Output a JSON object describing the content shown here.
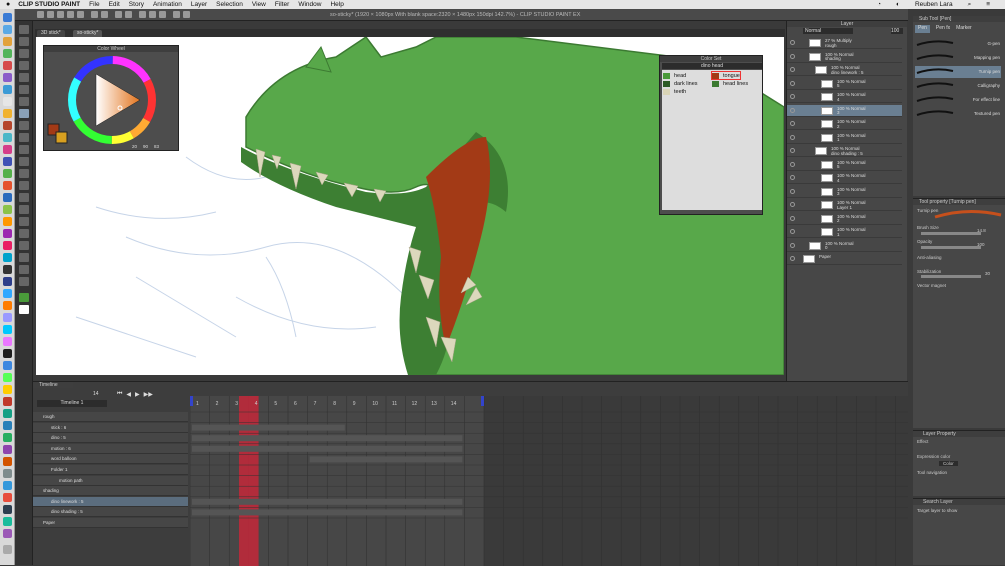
{
  "menubar": {
    "apple": "",
    "app": "CLIP STUDIO PAINT",
    "items": [
      "File",
      "Edit",
      "Story",
      "Animation",
      "Layer",
      "Selection",
      "View",
      "Filter",
      "Window",
      "Help"
    ],
    "user": "Reuben Lara"
  },
  "window": {
    "title": "so-sticky* (1920 × 1080px With blank space:2320 × 1480px 150dpi 142.7%) - CLIP STUDIO PAINT EX",
    "tabs": [
      "3D stick*",
      "so-sticky*"
    ]
  },
  "color_wheel": {
    "title": "Color Wheel",
    "h": "20",
    "s": "90",
    "v": "83"
  },
  "color_set": {
    "title": "Color Set",
    "set_name": "dino head",
    "items": [
      {
        "label": "head",
        "color": "#4a9a3a"
      },
      {
        "label": "dark lines",
        "color": "#2c5a24"
      },
      {
        "label": "teeth",
        "color": "#d9d4b6"
      },
      {
        "label": "tongue",
        "color": "#a33a16"
      },
      {
        "label": "head lines",
        "color": "#3b7a30"
      }
    ]
  },
  "layer_panel": {
    "title": "Layer",
    "blend_mode": "Normal",
    "opacity": "100",
    "layers": [
      {
        "text": "27 % Multiply\nrough"
      },
      {
        "text": "100 % Normal\nshading"
      },
      {
        "text": "100 % Normal\ndino linework : 5"
      },
      {
        "text": "100 % Normal\n5"
      },
      {
        "text": "100 % Normal\n4"
      },
      {
        "text": "100 % Normal\n3"
      },
      {
        "text": "100 % Normal\n2"
      },
      {
        "text": "100 % Normal\n1"
      },
      {
        "text": "100 % Normal\ndino shading : 5"
      },
      {
        "text": "100 % Normal\n5"
      },
      {
        "text": "100 % Normal\n4"
      },
      {
        "text": "100 % Normal\n3"
      },
      {
        "text": "100 % Normal\nLayer 1"
      },
      {
        "text": "100 % Normal\n2"
      },
      {
        "text": "100 % Normal\n1"
      },
      {
        "text": "100 % Normal\n0"
      },
      {
        "text": "Paper"
      }
    ]
  },
  "sub_tool": {
    "title": "Sub Tool [Pen]",
    "tabs": [
      "Pen",
      "Pen fx",
      "Marker"
    ],
    "brushes": [
      "G-pen",
      "Mapping pen",
      "Turnip pen",
      "Calligraphy",
      "For effect line",
      "Textured pen"
    ]
  },
  "tool_property": {
    "title": "Tool property [Turnip pen]",
    "name": "Turnip pen",
    "brush_size_label": "Brush Size",
    "brush_size": "14.8",
    "opacity_label": "Opacity",
    "opacity": "100",
    "anti_label": "Anti-aliasing",
    "stab_label": "Stabilization",
    "stab": "30",
    "vector_label": "Vector magnet"
  },
  "layer_property": {
    "title": "Layer Property",
    "effect": "Effect",
    "expr_label": "Expression color",
    "expr_value": "Color",
    "tool_nav": "Tool navigation"
  },
  "search_layer": {
    "title": "Search Layer",
    "target": "Target layer to show"
  },
  "timeline": {
    "title": "Timeline",
    "name": "Timeline 1",
    "frame_count": "14",
    "rows": [
      {
        "label": "rough",
        "indent": 0
      },
      {
        "label": "stick : 6",
        "indent": 1
      },
      {
        "label": "dino : 5",
        "indent": 1
      },
      {
        "label": "motion : 6",
        "indent": 1
      },
      {
        "label": "word balloon",
        "indent": 1
      },
      {
        "label": "Folder 1",
        "indent": 1
      },
      {
        "label": "motion path",
        "indent": 2
      },
      {
        "label": "shading",
        "indent": 0
      },
      {
        "label": "dino linework : 5",
        "indent": 1
      },
      {
        "label": "dino shading : 5",
        "indent": 1
      },
      {
        "label": "Paper",
        "indent": 0
      }
    ],
    "numbers": [
      "1",
      "2",
      "3",
      "4",
      "5",
      "6",
      "7",
      "8",
      "9",
      "10",
      "11",
      "12",
      "13",
      "14"
    ]
  }
}
